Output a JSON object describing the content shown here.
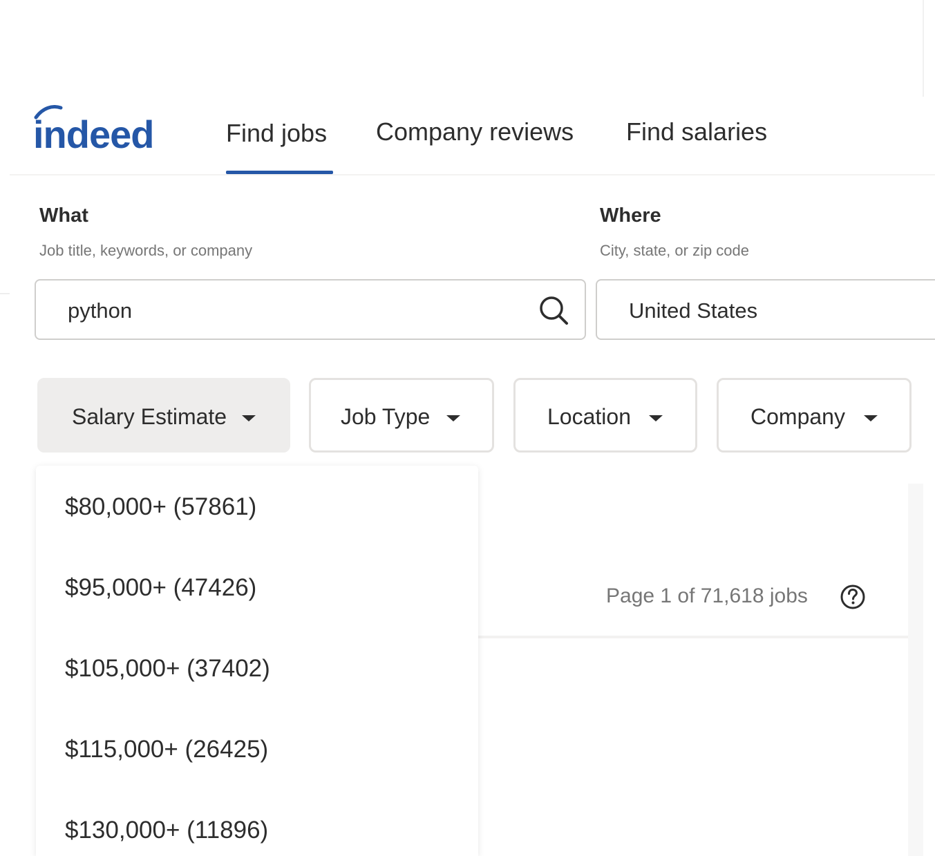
{
  "header": {
    "logo_text": "indeed",
    "tabs": [
      {
        "label": "Find jobs",
        "active": true
      },
      {
        "label": "Company reviews",
        "active": false
      },
      {
        "label": "Find salaries",
        "active": false
      }
    ]
  },
  "search": {
    "what": {
      "label": "What",
      "hint": "Job title, keywords, or company",
      "value": "python"
    },
    "where": {
      "label": "Where",
      "hint": "City, state, or zip code",
      "value": "United States"
    }
  },
  "filters": [
    {
      "label": "Salary Estimate",
      "open": true
    },
    {
      "label": "Job Type",
      "open": false
    },
    {
      "label": "Location",
      "open": false
    },
    {
      "label": "Company",
      "open": false
    }
  ],
  "salary_dropdown": {
    "options": [
      "$80,000+ (57861)",
      "$95,000+ (47426)",
      "$105,000+ (37402)",
      "$115,000+ (26425)",
      "$130,000+ (11896)"
    ]
  },
  "results": {
    "page_count": "Page 1 of 71,618 jobs"
  },
  "colors": {
    "brand_blue": "#2557a7",
    "text": "#2d2d2d",
    "muted": "#767676"
  },
  "icons": {
    "search": "search-icon",
    "help": "help-circle-icon",
    "caret": "caret-down-icon"
  }
}
